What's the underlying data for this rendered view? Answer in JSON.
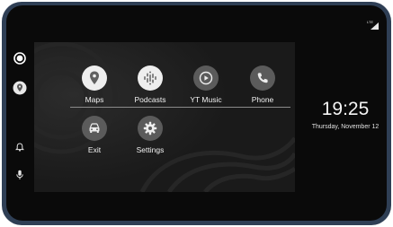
{
  "apps": [
    {
      "label": "Maps",
      "icon": "maps-icon",
      "color": "#eeeeee"
    },
    {
      "label": "Podcasts",
      "icon": "podcasts-icon",
      "color": "#eeeeee"
    },
    {
      "label": "YT Music",
      "icon": "yt-music-icon",
      "color": "#5b5b5b"
    },
    {
      "label": "Phone",
      "icon": "phone-icon",
      "color": "#5b5b5b"
    },
    {
      "label": "Exit",
      "icon": "car-icon",
      "color": "#5b5b5b"
    },
    {
      "label": "Settings",
      "icon": "settings-icon",
      "color": "#5b5b5b"
    }
  ],
  "status": {
    "network": "LTE",
    "signal_icon": "signal-icon"
  },
  "clock": {
    "time": "19:25",
    "date": "Thursday, November 12"
  },
  "rail": {
    "icons": [
      "home-icon",
      "maps-nav-icon",
      "notification-bell-icon",
      "microphone-icon"
    ]
  },
  "colors": {
    "frame": "#2f3f55",
    "screen": "#0a0a0a",
    "wallpaper": "#1c1c1c"
  }
}
